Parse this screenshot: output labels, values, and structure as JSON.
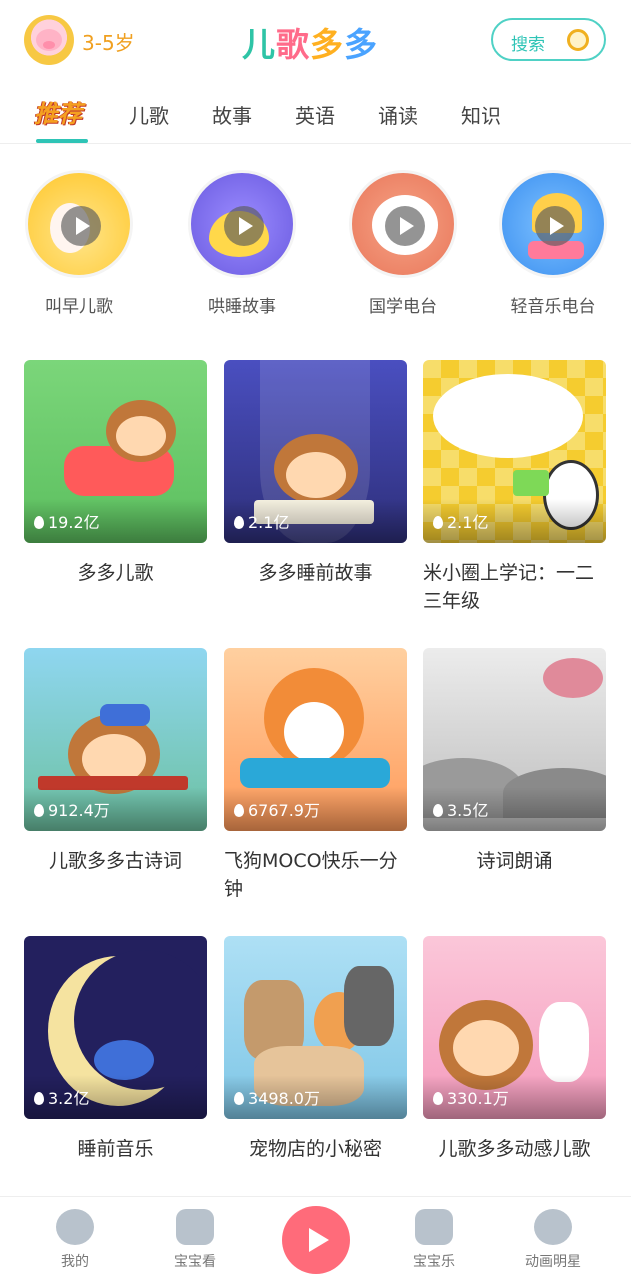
{
  "header": {
    "age_label": "3-5岁",
    "logo": [
      "儿",
      "歌",
      "多",
      "多"
    ],
    "search_label": "搜索"
  },
  "tabs": [
    {
      "label": "推荐",
      "active": true
    },
    {
      "label": "儿歌"
    },
    {
      "label": "故事"
    },
    {
      "label": "英语"
    },
    {
      "label": "诵读"
    },
    {
      "label": "知识"
    }
  ],
  "radios": [
    {
      "label": "叫早儿歌",
      "color": "#ffcc33"
    },
    {
      "label": "哄睡故事",
      "color": "#7b6cf6"
    },
    {
      "label": "国学电台",
      "color": "#f08a6a"
    },
    {
      "label": "轻音乐电台",
      "color": "#4aa3ff"
    }
  ],
  "cards": [
    {
      "title": "多多儿歌",
      "count": "19.2亿",
      "bg": "#6fcf6a"
    },
    {
      "title": "多多睡前故事",
      "count": "2.1亿",
      "bg": "#3a3f9e"
    },
    {
      "title": "米小圈上学记：一二三年级",
      "count": "2.1亿",
      "bg": "#f5cc2f"
    },
    {
      "title": "儿歌多多古诗词",
      "count": "912.4万",
      "bg": "#74c5e6"
    },
    {
      "title": "飞狗MOCO快乐一分钟",
      "count": "6767.9万",
      "bg": "#ffb070"
    },
    {
      "title": "诗词朗诵",
      "count": "3.5亿",
      "bg": "#d6d6d6"
    },
    {
      "title": "睡前音乐",
      "count": "3.2亿",
      "bg": "#23205e"
    },
    {
      "title": "宠物店的小秘密",
      "count": "3498.0万",
      "bg": "#9fd4ec"
    },
    {
      "title": "儿歌多多动感儿歌",
      "count": "330.1万",
      "bg": "#f7a8c4"
    }
  ],
  "bottom_nav": [
    {
      "label": "我的",
      "icon": "monkey-icon"
    },
    {
      "label": "宝宝看",
      "icon": "tv-icon"
    },
    {
      "label": "宝宝乐",
      "icon": "puzzle-icon"
    },
    {
      "label": "动画明星",
      "icon": "star-bear-icon"
    }
  ]
}
